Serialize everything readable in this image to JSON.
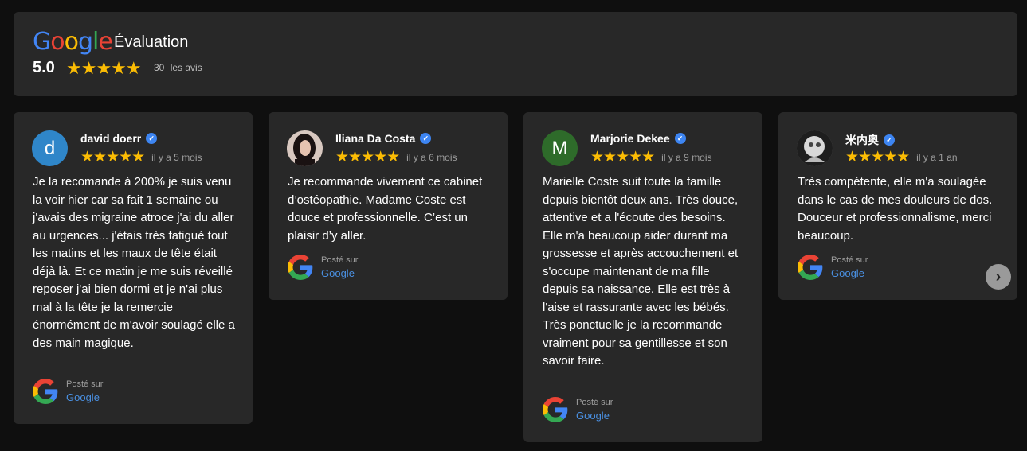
{
  "header": {
    "logo_letters": [
      "G",
      "o",
      "o",
      "g",
      "l",
      "e"
    ],
    "logo_colors": [
      "#4285f4",
      "#ea4335",
      "#fbbc04",
      "#4285f4",
      "#34a853",
      "#ea4335"
    ],
    "title": "Évaluation",
    "score": "5.0",
    "stars": "★★★★★",
    "count": "30",
    "count_label": "les avis"
  },
  "reviews": [
    {
      "avatar_letter": "d",
      "avatar_color": "#2f86c9",
      "name": "david doerr",
      "stars": "★★★★★",
      "time": "il y a 5 mois",
      "text": "Je la recomande à 200% je suis venu la voir hier car sa fait 1 semaine ou j'avais des migraine atroce j'ai du aller au urgences... j'étais très fatigué tout les matins et les maux de tête était déjà là. Et ce matin je me suis réveillé reposer j'ai bien dormi et je n'ai plus mal à la tête je la remercie énormément de m'avoir soulagé elle a des main magique.",
      "posted_label": "Posté sur",
      "posted_source": "Google"
    },
    {
      "avatar_letter": "",
      "avatar_color": "#3a3030",
      "name": "Iliana Da Costa",
      "stars": "★★★★★",
      "time": "il y a 6 mois",
      "text": "Je recommande vivement ce cabinet d’ostéopathie. Madame Coste est douce et professionnelle. C’est un plaisir d’y aller.",
      "posted_label": "Posté sur",
      "posted_source": "Google"
    },
    {
      "avatar_letter": "M",
      "avatar_color": "#2e6b2a",
      "name": "Marjorie Dekee",
      "stars": "★★★★★",
      "time": "il y a 9 mois",
      "text": "Marielle Coste suit toute la famille depuis bientôt deux ans. Très douce, attentive et a l'écoute des besoins. Elle m'a beaucoup aider durant ma grossesse et après accouchement et s'occupe maintenant de ma fille depuis sa naissance. Elle est très à l'aise et rassurante avec les bébés. Très ponctuelle je la recommande vraiment pour sa gentillesse et son savoir faire.",
      "posted_label": "Posté sur",
      "posted_source": "Google"
    },
    {
      "avatar_letter": "",
      "avatar_color": "#777777",
      "name": "米内奥",
      "stars": "★★★★★",
      "time": "il y a 1 an",
      "text": "Très compétente, elle m'a soulagée dans le cas de mes douleurs de dos. Douceur et professionnalisme, merci beaucoup.",
      "posted_label": "Posté sur",
      "posted_source": "Google"
    }
  ],
  "next_icon": "chevron-right-icon",
  "colors": {
    "star": "#fbbc04",
    "link": "#4a90e2",
    "card": "#282828",
    "background": "#0f0f0f"
  }
}
